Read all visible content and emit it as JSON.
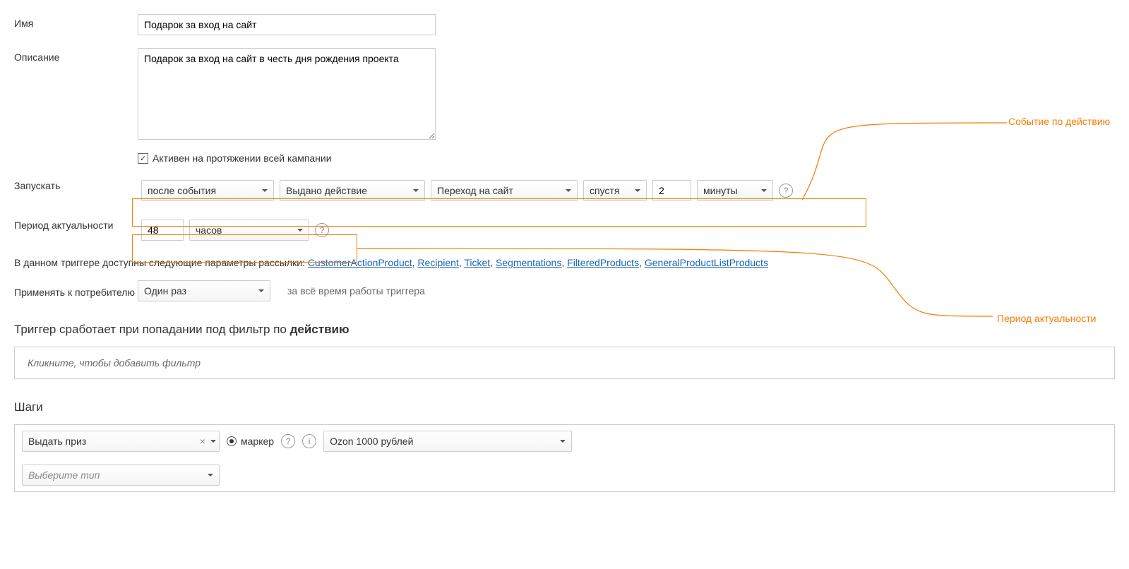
{
  "labels": {
    "name": "Имя",
    "description": "Описание",
    "run": "Запускать",
    "actuality": "Период актуальности",
    "apply_to": "Применять к потребителю"
  },
  "fields": {
    "name_value": "Подарок за вход на сайт",
    "description_value": "Подарок за вход на сайт в честь дня рождения проекта",
    "active_checkbox_label": "Активен на протяжении всей кампании",
    "active_checked": true
  },
  "run_row": {
    "trigger_type": "после события",
    "event_type": "Выдано действие",
    "action": "Переход на сайт",
    "delay_relation": "спустя",
    "delay_value": "2",
    "delay_unit": "минуты"
  },
  "actuality_row": {
    "value": "48",
    "unit": "часов"
  },
  "params_line": {
    "prefix": "В данном триггере доступны следующие параметры рассылки: ",
    "links": [
      "CustomerActionProduct",
      "Recipient",
      "Ticket",
      "Segmentations",
      "FilteredProducts",
      "GeneralProductListProducts"
    ]
  },
  "apply_row": {
    "value": "Один раз",
    "suffix": "за всё время работы триггера"
  },
  "filter_section": {
    "heading_prefix": "Триггер сработает при попадании под фильтр по ",
    "heading_bold": "действию",
    "placeholder": "Кликните, чтобы добавить фильтр"
  },
  "steps_section": {
    "heading": "Шаги",
    "action_select": "Выдать приз",
    "radio_label": "маркер",
    "prize_select": "Ozon 1000 рублей",
    "type_placeholder": "Выберите тип"
  },
  "annotations": {
    "event": "Событие по действию",
    "actuality": "Период актуальности"
  },
  "icons": {
    "help": "?",
    "info": "i",
    "check": "✓",
    "clear": "×"
  }
}
